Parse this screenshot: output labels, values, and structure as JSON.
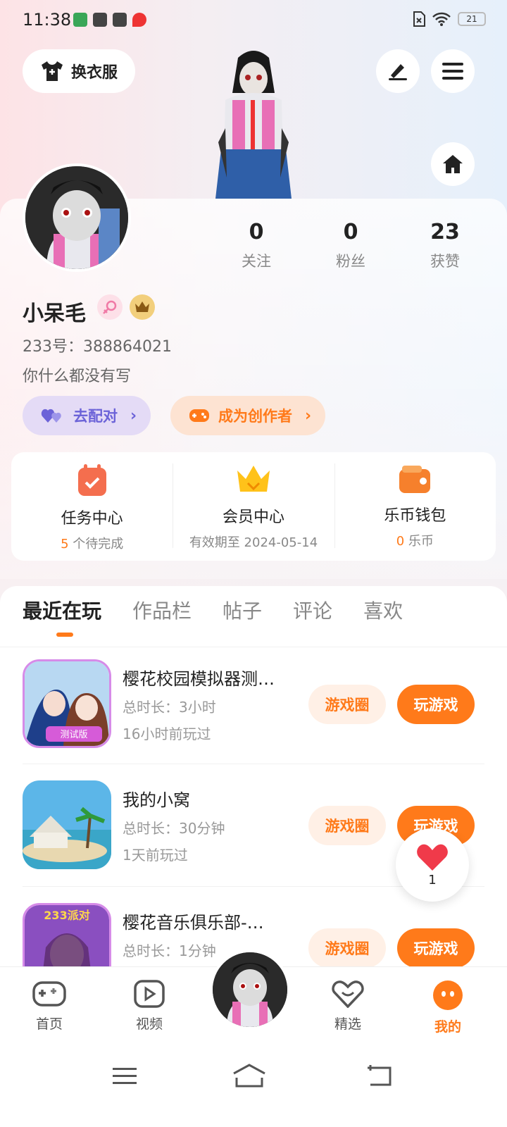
{
  "status_bar": {
    "time": "11:38",
    "battery": "21"
  },
  "header": {
    "dress_up_label": "换衣服"
  },
  "profile": {
    "stats": [
      {
        "num": "0",
        "label": "关注"
      },
      {
        "num": "0",
        "label": "粉丝"
      },
      {
        "num": "23",
        "label": "获赞"
      }
    ],
    "username": "小呆毛",
    "uid": "233号：388864021",
    "bio": "你什么都没有写",
    "match_label": "去配对",
    "creator_label": "成为创作者"
  },
  "centers": [
    {
      "title": "任务中心",
      "sub_hl": "5",
      "sub": " 个待完成"
    },
    {
      "title": "会员中心",
      "sub_hl": "",
      "sub": "有效期至 2024-05-14"
    },
    {
      "title": "乐币钱包",
      "sub_hl": "0",
      "sub": " 乐币"
    }
  ],
  "tabs": [
    "最近在玩",
    "作品栏",
    "帖子",
    "评论",
    "喜欢"
  ],
  "games": [
    {
      "title": "樱花校园模拟器测…",
      "duration": "总时长：3小时",
      "last": "16小时前玩过",
      "icon_text": "测试版"
    },
    {
      "title": "我的小窝",
      "duration": "总时长：30分钟",
      "last": "1天前玩过"
    },
    {
      "title": "樱花音乐俱乐部-…",
      "duration": "总时长：1分钟",
      "icon_text": "233派对"
    }
  ],
  "game_buttons": {
    "circle": "游戏圈",
    "play": "玩游戏"
  },
  "float_like": {
    "count": "1"
  },
  "bottom_nav": [
    {
      "label": "首页"
    },
    {
      "label": "视频"
    },
    {
      "label": "精选"
    },
    {
      "label": "我的"
    }
  ],
  "colors": {
    "accent": "#ff7a1a",
    "match": "#6c63d8"
  }
}
